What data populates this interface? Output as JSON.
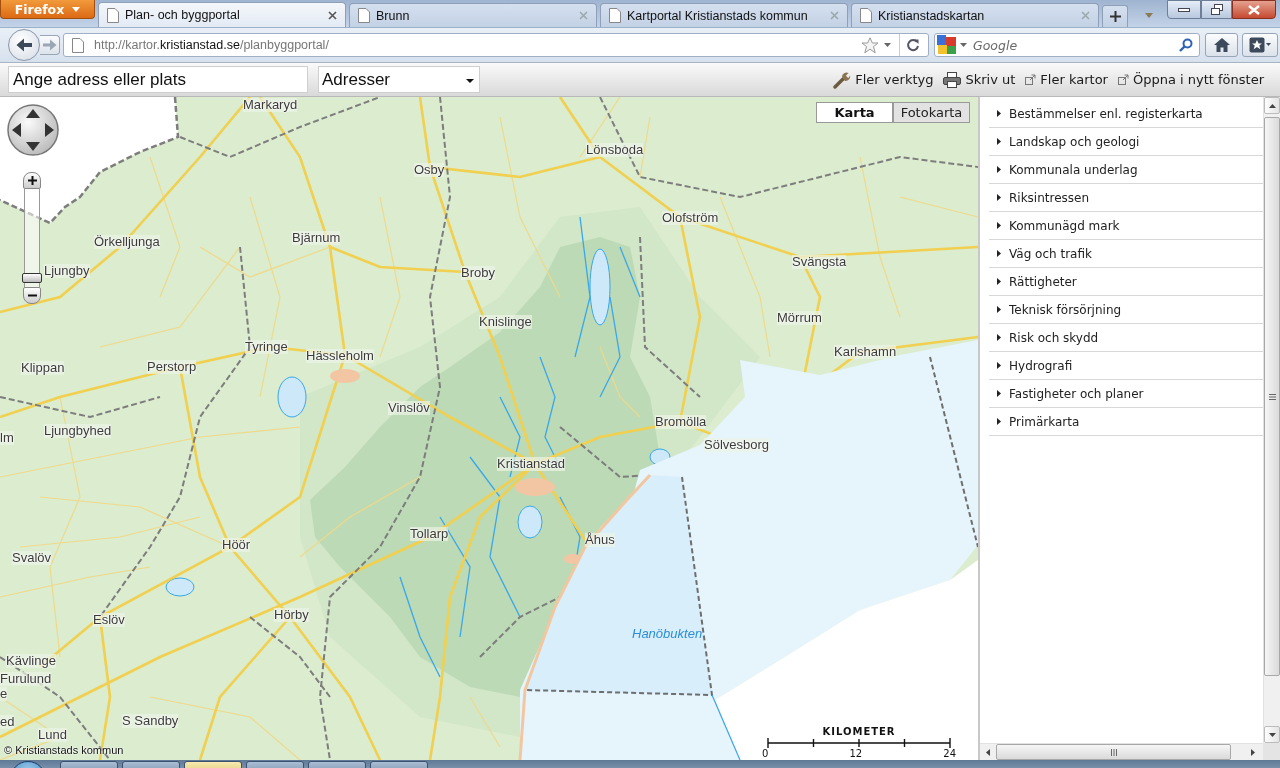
{
  "browser": {
    "menu_button": "Firefox",
    "tabs": [
      {
        "title": "Plan- och byggportal",
        "selected": true
      },
      {
        "title": "Brunn",
        "selected": false
      },
      {
        "title": "Kartportal Kristianstads kommun",
        "selected": false
      },
      {
        "title": "Kristianstadskartan",
        "selected": false
      }
    ],
    "url": {
      "prefix": "http://kartor.",
      "domain": "kristianstad.se",
      "path": "/planbyggportal/"
    },
    "search": {
      "placeholder": "Google"
    }
  },
  "toolbar": {
    "address_field": {
      "placeholder": "Ange adress eller plats"
    },
    "layer_select": {
      "value": "Adresser"
    },
    "actions": [
      {
        "label": "Fler verktyg",
        "kind": "tools"
      },
      {
        "label": "Skriv ut",
        "kind": "print"
      },
      {
        "label": "Fler kartor",
        "kind": "external"
      },
      {
        "label": "Öppna i nytt fönster",
        "kind": "external"
      }
    ]
  },
  "map": {
    "view_buttons": [
      {
        "label": "Karta",
        "selected": true
      },
      {
        "label": "Fotokarta",
        "selected": false
      }
    ],
    "zoom_slider": {
      "level": 0.05
    },
    "place_labels": [
      "Markaryd",
      "Lönsboda",
      "Osby",
      "Bjärnum",
      "Örkelljunga",
      "Olofström",
      "Svängsta",
      "Ljungby",
      "Broby",
      "Knislinge",
      "Mörrum",
      "Tyringe",
      "Hässleholm",
      "Karlshamn",
      "Klippan",
      "Perstorp",
      "Vinslöv",
      "Bromölla",
      "Sölvesborg",
      "Ljungbyhed",
      "lm",
      "Kristianstad",
      "Tollarp",
      "Åhus",
      "Svalöv",
      "Höör",
      "Eslöv",
      "Hörby",
      "Kävlinge",
      "Furulund",
      "e",
      "ed",
      "S Sandby",
      "Lund"
    ],
    "sea_label": "Hanöbukten",
    "scale": {
      "title": "KILOMETER",
      "ticks": [
        "0",
        "12",
        "24"
      ]
    },
    "copyright": "© Kristianstads kommun"
  },
  "sidebar": {
    "items": [
      {
        "label": "Bestämmelser enl. registerkarta",
        "expanded": false
      },
      {
        "label": "Landskap och geologi",
        "expanded": false
      },
      {
        "label": "Kommunala underlag",
        "expanded": false
      },
      {
        "label": "Riksintressen",
        "expanded": false
      },
      {
        "label": "Kommunägd mark",
        "expanded": false
      },
      {
        "label": "Väg och trafik",
        "expanded": false
      },
      {
        "label": "Rättigheter",
        "expanded": false
      },
      {
        "label": "Teknisk försörjning",
        "expanded": false
      },
      {
        "label": "Risk och skydd",
        "expanded": false
      },
      {
        "label": "Hydrografi",
        "expanded": false
      },
      {
        "label": "Fastigheter och planer",
        "expanded": false
      },
      {
        "label": "Primärkarta",
        "expanded": false
      }
    ]
  }
}
